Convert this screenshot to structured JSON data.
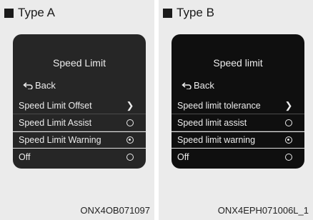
{
  "panels": [
    {
      "type_label": "Type A",
      "screen_title": "Speed Limit",
      "back_label": "Back",
      "rows": [
        {
          "label": "Speed Limit Offset",
          "indicator": "chevron"
        },
        {
          "label": "Speed Limit Assist",
          "indicator": "radio-off"
        },
        {
          "label": "Speed Limit Warning",
          "indicator": "radio-on"
        },
        {
          "label": "Off",
          "indicator": "radio-off"
        }
      ],
      "caption": "ONX4OB071097"
    },
    {
      "type_label": "Type B",
      "screen_title": "Speed limit",
      "back_label": "Back",
      "rows": [
        {
          "label": "Speed limit tolerance",
          "indicator": "chevron"
        },
        {
          "label": "Speed limit assist",
          "indicator": "radio-off"
        },
        {
          "label": "Speed limit warning",
          "indicator": "radio-on"
        },
        {
          "label": "Off",
          "indicator": "radio-off"
        }
      ],
      "caption": "ONX4EPH071006L_1"
    }
  ],
  "icons": {
    "back": "back-arrow-icon",
    "chevron": "chevron-right-icon",
    "radio": "radio-button"
  },
  "colors": {
    "screen_a": "#262626",
    "screen_b": "#0f0f0f",
    "text": "#ececec",
    "panel_bg": "#ebebeb"
  }
}
